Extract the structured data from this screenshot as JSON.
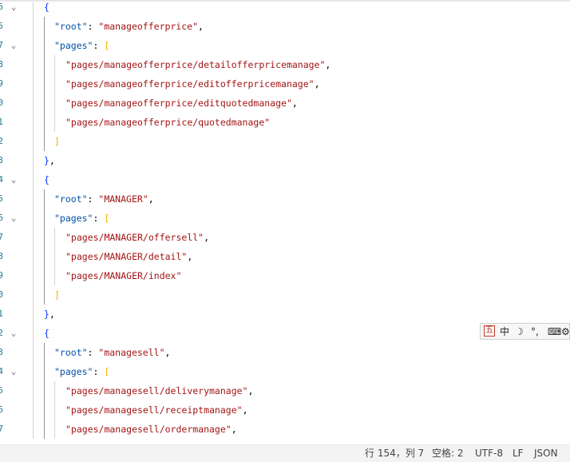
{
  "editor": {
    "lines": [
      {
        "num": "6",
        "fold": "⌄",
        "indent": 1,
        "tokens": [
          {
            "t": "{",
            "c": "b1"
          }
        ]
      },
      {
        "num": "5",
        "fold": "",
        "indent": 2,
        "tokens": [
          {
            "t": "\"root\"",
            "c": "k"
          },
          {
            "t": ": ",
            "c": "p"
          },
          {
            "t": "\"manageofferprice\"",
            "c": "s"
          },
          {
            "t": ",",
            "c": "p"
          }
        ]
      },
      {
        "num": "7",
        "fold": "⌄",
        "indent": 2,
        "tokens": [
          {
            "t": "\"pages\"",
            "c": "k"
          },
          {
            "t": ": ",
            "c": "p"
          },
          {
            "t": "[",
            "c": "b2"
          }
        ]
      },
      {
        "num": "8",
        "fold": "",
        "indent": 3,
        "tokens": [
          {
            "t": "\"pages/manageofferprice/detailofferpricemanage\"",
            "c": "s"
          },
          {
            "t": ",",
            "c": "p"
          }
        ]
      },
      {
        "num": "9",
        "fold": "",
        "indent": 3,
        "tokens": [
          {
            "t": "\"pages/manageofferprice/editofferpricemanage\"",
            "c": "s"
          },
          {
            "t": ",",
            "c": "p"
          }
        ]
      },
      {
        "num": "0",
        "fold": "",
        "indent": 3,
        "tokens": [
          {
            "t": "\"pages/manageofferprice/editquotedmanage\"",
            "c": "s"
          },
          {
            "t": ",",
            "c": "p"
          }
        ]
      },
      {
        "num": "1",
        "fold": "",
        "indent": 3,
        "tokens": [
          {
            "t": "\"pages/manageofferprice/quotedmanage\"",
            "c": "s"
          }
        ]
      },
      {
        "num": "2",
        "fold": "",
        "indent": 2,
        "tokens": [
          {
            "t": "]",
            "c": "b2"
          }
        ]
      },
      {
        "num": "3",
        "fold": "",
        "indent": 1,
        "tokens": [
          {
            "t": "}",
            "c": "b1"
          },
          {
            "t": ",",
            "c": "p"
          }
        ]
      },
      {
        "num": "4",
        "fold": "⌄",
        "indent": 1,
        "tokens": [
          {
            "t": "{",
            "c": "b1"
          }
        ]
      },
      {
        "num": "5",
        "fold": "",
        "indent": 2,
        "tokens": [
          {
            "t": "\"root\"",
            "c": "k"
          },
          {
            "t": ": ",
            "c": "p"
          },
          {
            "t": "\"MANAGER\"",
            "c": "s"
          },
          {
            "t": ",",
            "c": "p"
          }
        ]
      },
      {
        "num": "6",
        "fold": "⌄",
        "indent": 2,
        "tokens": [
          {
            "t": "\"pages\"",
            "c": "k"
          },
          {
            "t": ": ",
            "c": "p"
          },
          {
            "t": "[",
            "c": "b2"
          }
        ]
      },
      {
        "num": "7",
        "fold": "",
        "indent": 3,
        "tokens": [
          {
            "t": "\"pages/MANAGER/offersell\"",
            "c": "s"
          },
          {
            "t": ",",
            "c": "p"
          }
        ]
      },
      {
        "num": "8",
        "fold": "",
        "indent": 3,
        "tokens": [
          {
            "t": "\"pages/MANAGER/detail\"",
            "c": "s"
          },
          {
            "t": ",",
            "c": "p"
          }
        ]
      },
      {
        "num": "9",
        "fold": "",
        "indent": 3,
        "tokens": [
          {
            "t": "\"pages/MANAGER/index\"",
            "c": "s"
          }
        ]
      },
      {
        "num": "0",
        "fold": "",
        "indent": 2,
        "tokens": [
          {
            "t": "]",
            "c": "b2"
          }
        ]
      },
      {
        "num": "1",
        "fold": "",
        "indent": 1,
        "tokens": [
          {
            "t": "}",
            "c": "b1"
          },
          {
            "t": ",",
            "c": "p"
          }
        ]
      },
      {
        "num": "2",
        "fold": "⌄",
        "indent": 1,
        "tokens": [
          {
            "t": "{",
            "c": "b1"
          }
        ]
      },
      {
        "num": "3",
        "fold": "",
        "indent": 2,
        "tokens": [
          {
            "t": "\"root\"",
            "c": "k"
          },
          {
            "t": ": ",
            "c": "p"
          },
          {
            "t": "\"managesell\"",
            "c": "s"
          },
          {
            "t": ",",
            "c": "p"
          }
        ]
      },
      {
        "num": "4",
        "fold": "⌄",
        "indent": 2,
        "tokens": [
          {
            "t": "\"pages\"",
            "c": "k"
          },
          {
            "t": ": ",
            "c": "p"
          },
          {
            "t": "[",
            "c": "b2"
          }
        ]
      },
      {
        "num": "5",
        "fold": "",
        "indent": 3,
        "tokens": [
          {
            "t": "\"pages/managesell/deliverymanage\"",
            "c": "s"
          },
          {
            "t": ",",
            "c": "p"
          }
        ]
      },
      {
        "num": "6",
        "fold": "",
        "indent": 3,
        "tokens": [
          {
            "t": "\"pages/managesell/receiptmanage\"",
            "c": "s"
          },
          {
            "t": ",",
            "c": "p"
          }
        ]
      },
      {
        "num": "7",
        "fold": "",
        "indent": 3,
        "tokens": [
          {
            "t": "\"pages/managesell/ordermanage\"",
            "c": "s"
          },
          {
            "t": ",",
            "c": "p"
          }
        ]
      }
    ]
  },
  "ime_toolbar": {
    "logo": "五",
    "mode": "中",
    "moon": "☽",
    "punct": "°,",
    "keyboard": "⌨",
    "tools": "⚙"
  },
  "statusbar": {
    "position": "行 154，列 7",
    "indent": "空格: 2",
    "encoding": "UTF-8",
    "eol": "LF",
    "language": "JSON"
  },
  "colors": {
    "key": "#0451a5",
    "string": "#a31515",
    "brace": "#0431fa",
    "bracket": "#f0b400",
    "line_number": "#237893"
  }
}
